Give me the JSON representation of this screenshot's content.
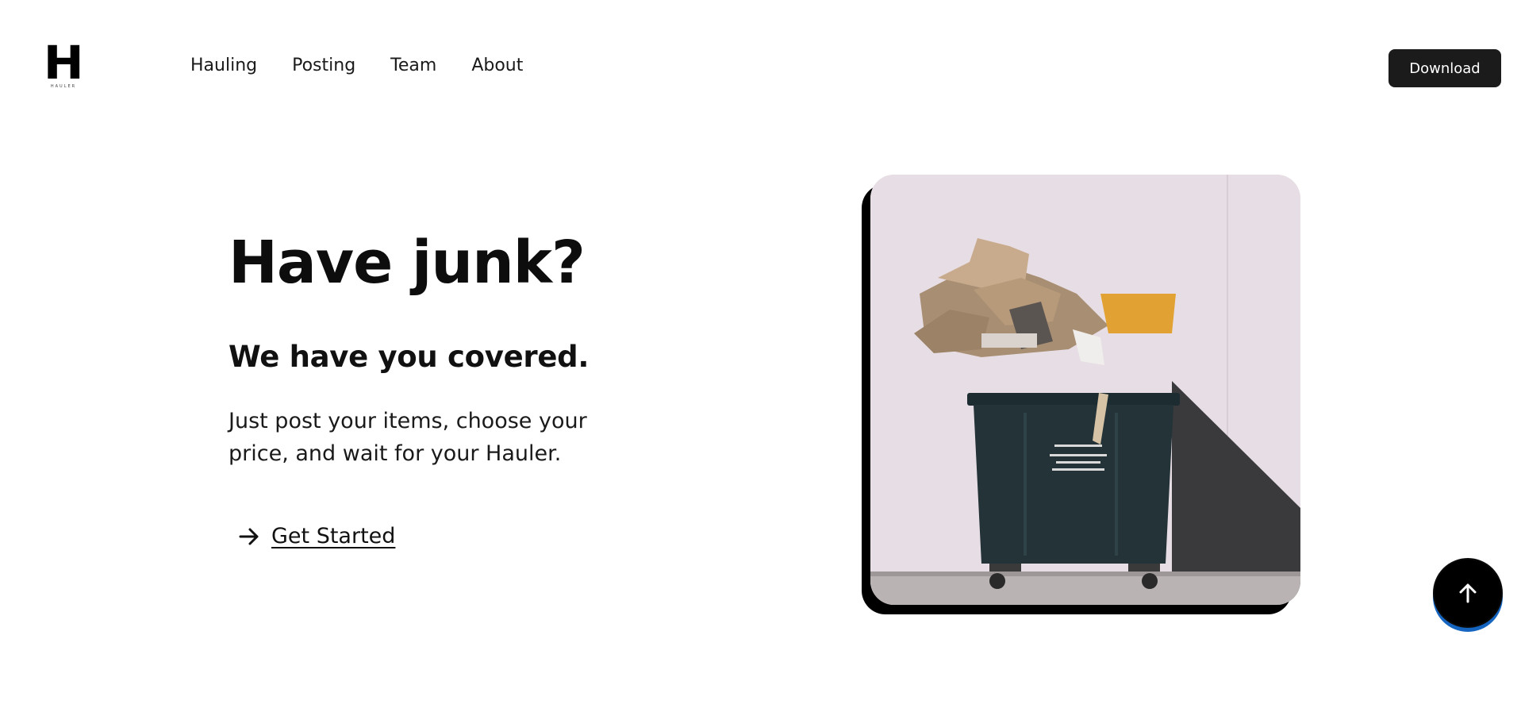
{
  "header": {
    "logo": {
      "mark": "H",
      "wordmark": "HAULER"
    },
    "nav": [
      {
        "label": "Hauling"
      },
      {
        "label": "Posting"
      },
      {
        "label": "Team"
      },
      {
        "label": "About"
      }
    ],
    "download_label": "Download"
  },
  "hero": {
    "title": "Have junk?",
    "subtitle": "We have you covered.",
    "description": "Just post your items, choose your price, and wait for your Hauler.",
    "cta_label": "Get Started",
    "cta_icon": "arrow-right-icon",
    "image_subject": "overflowing-dumpster-photo"
  },
  "scroll_top": {
    "icon": "arrow-up-icon"
  },
  "colors": {
    "background": "#ffffff",
    "text": "#111111",
    "button_dark": "#1b1b1b",
    "accent_blue": "#1565c0",
    "wall": "#e6dce3"
  }
}
